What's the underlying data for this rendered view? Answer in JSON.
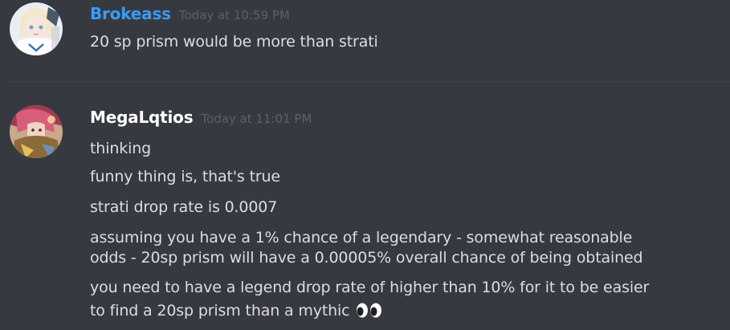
{
  "messages": [
    {
      "username": "Brokeass",
      "username_color": "#3b9bf2",
      "timestamp": "Today at 10:59 PM",
      "lines": [
        "20 sp prism would be more than strati"
      ]
    },
    {
      "username": "MegaLqtios",
      "username_color": "#ffffff",
      "timestamp": "Today at 11:01 PM",
      "lines": [
        "thinking",
        "funny thing is, that's true",
        "strati drop rate is 0.0007",
        "assuming you have a 1% chance of a legendary - somewhat reasonable",
        "odds - 20sp prism will have a 0.00005% overall chance of being obtained",
        "you need to have a legend drop rate of higher than 10% for it to be easier",
        "to find a 20sp prism than a mythic"
      ],
      "trailing_emoji": "eyes-emoji"
    }
  ],
  "colors": {
    "background": "#36393f",
    "text": "#dcddde",
    "timestamp": "#5d6066",
    "divider": "#42454a"
  }
}
